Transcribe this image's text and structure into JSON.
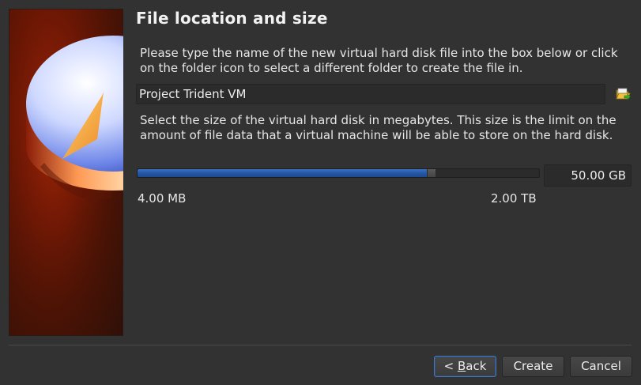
{
  "dialog": {
    "title": "File location and size",
    "location_description": "Please type the name of the new virtual hard disk file into the box below or click on the folder icon to select a different folder to create the file in.",
    "file_name_value": "Project Trident VM",
    "folder_icon": "folder-open-icon",
    "size_description": "Select the size of the virtual hard disk in megabytes. This size is the limit on the amount of file data that a virtual machine will be able to store on the hard disk.",
    "size": {
      "value": "50.00 GB",
      "min_label": "4.00 MB",
      "max_label": "2.00 TB",
      "slider_fraction": 0.72
    },
    "buttons": {
      "back_prefix": "< ",
      "back_mnemonic": "B",
      "back_rest": "ack",
      "create": "Create",
      "cancel": "Cancel"
    }
  },
  "colors": {
    "background": "#323232",
    "slider_fill": "#2557a6",
    "banner": "#6b1604",
    "focus_border": "#4a78b8"
  }
}
